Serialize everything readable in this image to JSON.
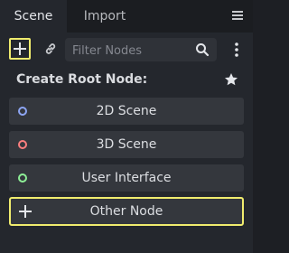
{
  "tabs": [
    {
      "label": "Scene",
      "active": true
    },
    {
      "label": "Import",
      "active": false
    }
  ],
  "toolbar": {
    "add_icon": "plus-icon",
    "link_icon": "link-icon",
    "filter_placeholder": "Filter Nodes",
    "search_icon": "search-icon",
    "menu_icon": "kebab-menu-icon"
  },
  "header": {
    "title": "Create Root Node:",
    "favorite_icon": "star-icon"
  },
  "nodes": [
    {
      "label": "2D Scene",
      "icon": "node2d-icon",
      "color": "#8da5f3"
    },
    {
      "label": "3D Scene",
      "icon": "node3d-icon",
      "color": "#fc7f7f"
    },
    {
      "label": "User Interface",
      "icon": "control-icon",
      "color": "#8eef97"
    },
    {
      "label": "Other Node",
      "icon": "plus-icon",
      "color": "#d6d8dc"
    }
  ],
  "colors": {
    "highlight": "#f0ec6e",
    "panel_bg": "#24272d",
    "button_bg": "#34373d"
  }
}
